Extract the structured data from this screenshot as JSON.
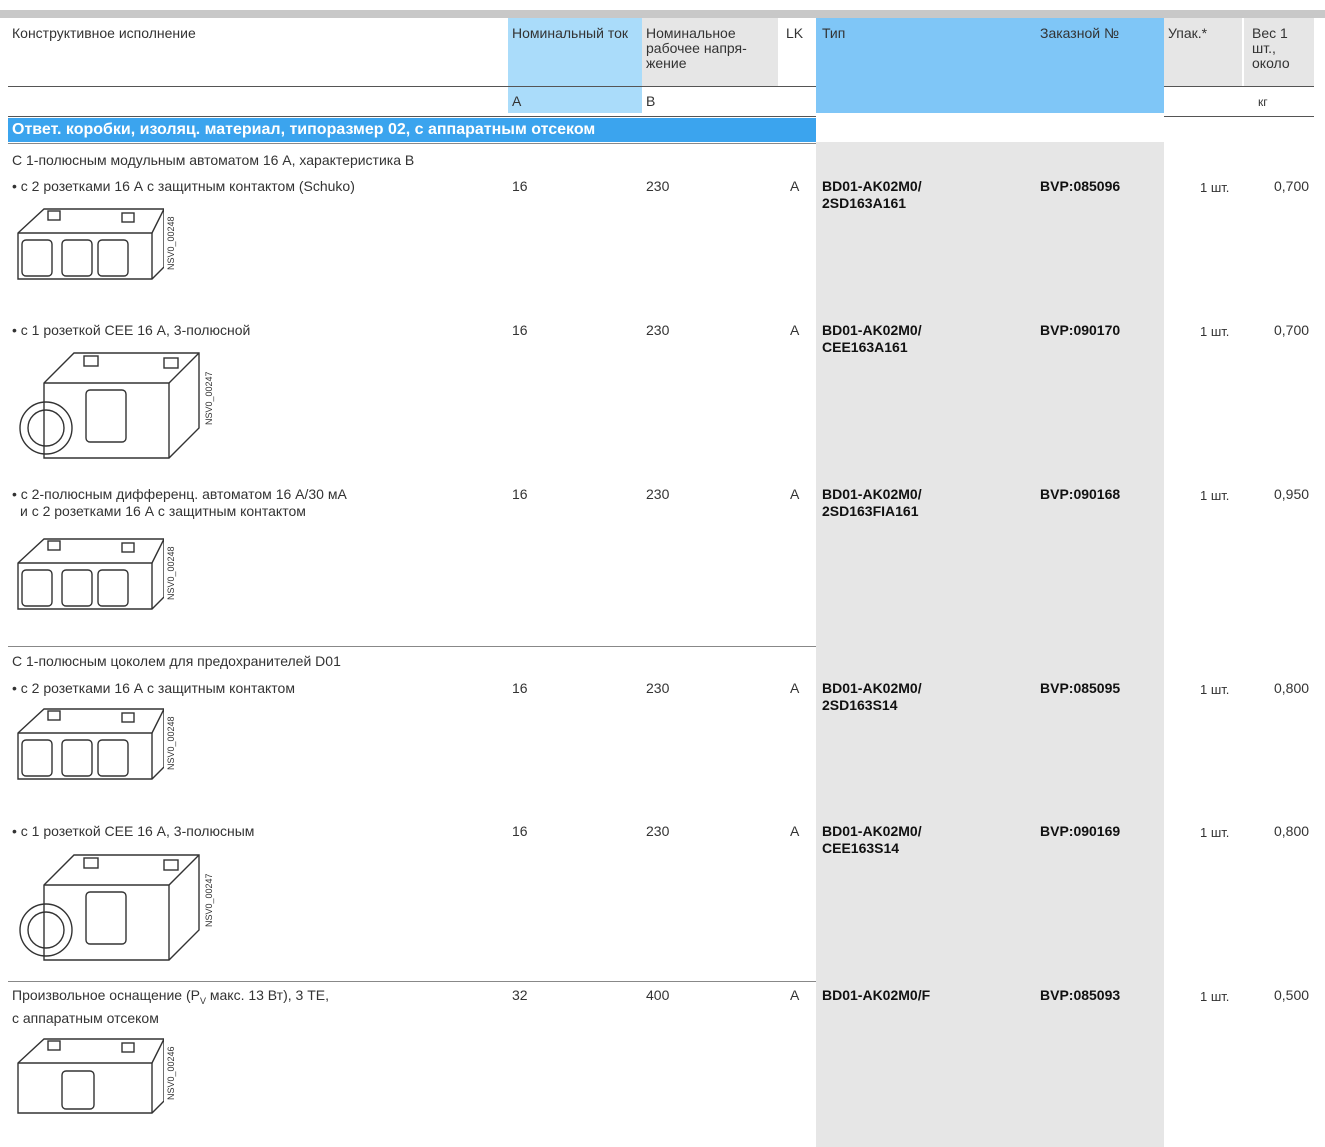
{
  "headers": {
    "design": "Конструктивное исполнение",
    "current": "Номинальный ток",
    "voltage": "Номинальное рабочее напря-жение",
    "lk": "LK",
    "type": "Тип",
    "order": "Заказной №",
    "pack": "Упак.*",
    "weight": "Вес 1 шт., около",
    "unit_current": "А",
    "unit_voltage": "В",
    "unit_weight": "кг"
  },
  "section_title": "Ответ. коробки, изоляц. материал, типоразмер 02, с аппаратным отсеком",
  "groups": [
    {
      "title": "С 1-полюсным модульным автоматом 16 А, характеристика В"
    },
    {
      "title": "С 1-полюсным цоколем для предохранителей D01"
    }
  ],
  "rows": [
    {
      "desc": "• с 2 розетками 16 А с защитным контактом (Schuko)",
      "desc2": "",
      "current": "16",
      "voltage": "230",
      "lk": "A",
      "type1": "BD01-AK02M0/",
      "type2": "2SD163A161",
      "order": "BVP:085096",
      "pack": "1 шт.",
      "weight": "0,700",
      "img_code": "NSV0_00248"
    },
    {
      "desc": "• с 1 розеткой CEE 16 А, 3-полюсной",
      "desc2": "",
      "current": "16",
      "voltage": "230",
      "lk": "A",
      "type1": "BD01-AK02M0/",
      "type2": "CEE163A161",
      "order": "BVP:090170",
      "pack": "1 шт.",
      "weight": "0,700",
      "img_code": "NSV0_00247"
    },
    {
      "desc": "• с 2-полюсным дифференц. автоматом 16 А/30 мА",
      "desc2": "и с 2 розетками 16 А с защитным контактом",
      "current": "16",
      "voltage": "230",
      "lk": "A",
      "type1": "BD01-AK02M0/",
      "type2": "2SD163FIA161",
      "order": "BVP:090168",
      "pack": "1 шт.",
      "weight": "0,950",
      "img_code": "NSV0_00248"
    },
    {
      "desc": "• с 2 розетками 16 А с защитным контактом",
      "desc2": "",
      "current": "16",
      "voltage": "230",
      "lk": "A",
      "type1": "BD01-AK02M0/",
      "type2": "2SD163S14",
      "order": "BVP:085095",
      "pack": "1 шт.",
      "weight": "0,800",
      "img_code": "NSV0_00248"
    },
    {
      "desc": "• с 1 розеткой CEE 16 А, 3-полюсным",
      "desc2": "",
      "current": "16",
      "voltage": "230",
      "lk": "A",
      "type1": "BD01-AK02M0/",
      "type2": "CEE163S14",
      "order": "BVP:090169",
      "pack": "1 шт.",
      "weight": "0,800",
      "img_code": "NSV0_00247"
    },
    {
      "desc_pre": "Произвольное оснащение (P",
      "desc_sub": "V",
      "desc_post": " макс. 13 Вт), 3 TE,",
      "desc2": "с аппаратным отсеком",
      "current": "32",
      "voltage": "400",
      "lk": "A",
      "type1": "BD01-AK02M0/F",
      "type2": "",
      "order": "BVP:085093",
      "pack": "1 шт.",
      "weight": "0,500",
      "img_code": "NSV0_00246"
    }
  ]
}
